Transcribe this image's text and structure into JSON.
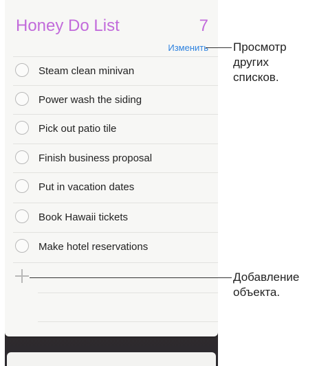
{
  "list": {
    "title": "Honey Do List",
    "count": "7",
    "edit_label": "Изменить",
    "items": [
      {
        "label": "Steam clean minivan"
      },
      {
        "label": "Power wash the siding"
      },
      {
        "label": "Pick out patio tile"
      },
      {
        "label": "Finish business proposal"
      },
      {
        "label": "Put in vacation dates"
      },
      {
        "label": "Book Hawaii tickets"
      },
      {
        "label": "Make hotel reservations"
      }
    ]
  },
  "callouts": {
    "view_lists_line1": "Просмотр",
    "view_lists_line2": "других",
    "view_lists_line3": "списков.",
    "add_item_line1": "Добавление",
    "add_item_line2": "объекта."
  },
  "colors": {
    "title": "#c26bdb",
    "accent": "#2f83e0"
  }
}
